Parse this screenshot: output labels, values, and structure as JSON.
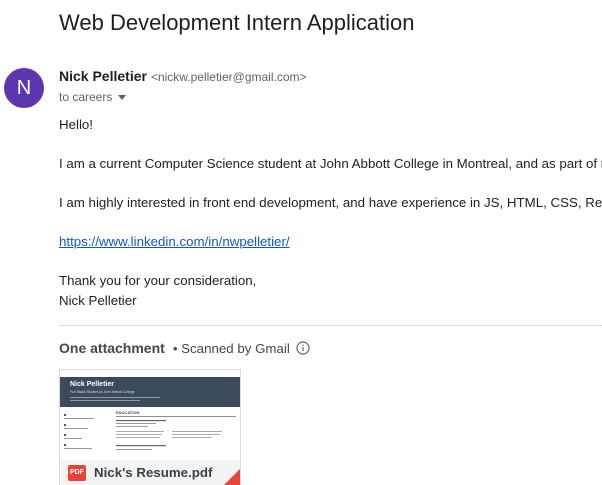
{
  "email": {
    "subject": "Web Development Intern Application",
    "sender": {
      "initial": "N",
      "name": "Nick Pelletier",
      "email": "<nickw.pelletier@gmail.com>",
      "avatar_color": "#5e35b1"
    },
    "to_line": "to careers",
    "body": {
      "greeting": "Hello!",
      "paragraph1": "I am a current Computer Science student at John Abbott College in Montreal, and as part of my",
      "paragraph2": "I am highly interested in front end development, and have experience in JS, HTML, CSS, React",
      "link": "https://www.linkedin.com/in/nwpelletier/",
      "closing": "Thank you for your consideration,",
      "signature": "Nick Pelletier"
    }
  },
  "attachments": {
    "header": "One attachment",
    "scanned_label": "• Scanned by Gmail",
    "info_icon": "info-icon",
    "items": [
      {
        "file_name": "Nick's Resume.pdf",
        "type_badge": "PDF",
        "badge_color": "#ea4335",
        "preview": {
          "name": "Nick Pelletier",
          "subtitle": "Full Stack Student at John Abbott College",
          "section_title": "EDUCATION"
        }
      }
    ]
  }
}
